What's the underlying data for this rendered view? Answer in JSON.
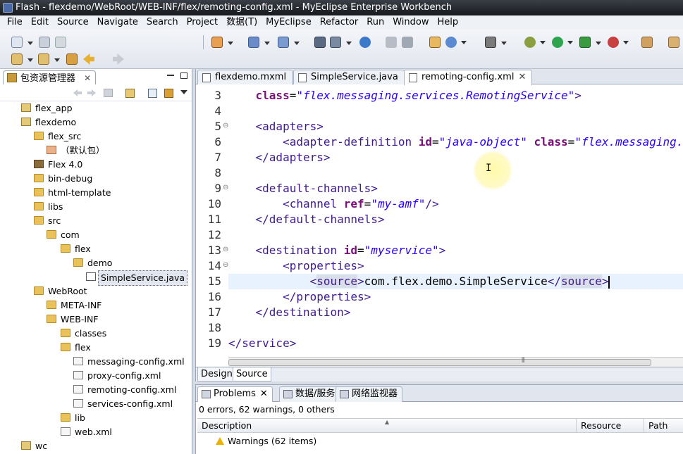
{
  "window": {
    "title": "Flash - flexdemo/WebRoot/WEB-INF/flex/remoting-config.xml - MyEclipse Enterprise Workbench"
  },
  "menu": [
    "File",
    "Edit",
    "Source",
    "Navigate",
    "Search",
    "Project",
    "数据(T)",
    "MyEclipse",
    "Refactor",
    "Run",
    "Window",
    "Help"
  ],
  "package_explorer": {
    "title": "包资源管理器",
    "close": "✕",
    "tree": [
      {
        "label": "flex_app",
        "type": "project"
      },
      {
        "label": "flexdemo",
        "type": "project"
      },
      {
        "label": "flex_src",
        "type": "folder"
      },
      {
        "label": "（默认包）",
        "type": "pkg"
      },
      {
        "label": "Flex 4.0",
        "type": "lib"
      },
      {
        "label": "bin-debug",
        "type": "folder"
      },
      {
        "label": "html-template",
        "type": "folder"
      },
      {
        "label": "libs",
        "type": "folder"
      },
      {
        "label": "src",
        "type": "folder"
      },
      {
        "label": "com",
        "type": "folder"
      },
      {
        "label": "flex",
        "type": "folder"
      },
      {
        "label": "demo",
        "type": "folder"
      },
      {
        "label": "SimpleService.java",
        "type": "java"
      },
      {
        "label": "WebRoot",
        "type": "folder"
      },
      {
        "label": "META-INF",
        "type": "folder"
      },
      {
        "label": "WEB-INF",
        "type": "folder"
      },
      {
        "label": "classes",
        "type": "folder"
      },
      {
        "label": "flex",
        "type": "folder"
      },
      {
        "label": "messaging-config.xml",
        "type": "xml"
      },
      {
        "label": "proxy-config.xml",
        "type": "xml"
      },
      {
        "label": "remoting-config.xml",
        "type": "xml"
      },
      {
        "label": "services-config.xml",
        "type": "xml"
      },
      {
        "label": "lib",
        "type": "folder"
      },
      {
        "label": "web.xml",
        "type": "xml"
      },
      {
        "label": "wc",
        "type": "project"
      }
    ]
  },
  "editor": {
    "tabs": [
      {
        "label": "flexdemo.mxml",
        "active": false
      },
      {
        "label": "SimpleService.java",
        "active": false
      },
      {
        "label": "remoting-config.xml",
        "active": true
      }
    ],
    "tab_close": "✕",
    "lines": [
      {
        "n": "3",
        "fold": "",
        "indent": "    ",
        "parts": [
          [
            "attr",
            "class"
          ],
          [
            "plain",
            "="
          ],
          [
            "val",
            "\"flex.messaging.services.RemotingService\""
          ],
          [
            "tag",
            ">"
          ]
        ]
      },
      {
        "n": "4",
        "fold": "",
        "indent": "",
        "parts": []
      },
      {
        "n": "5",
        "fold": "⊖",
        "indent": "    ",
        "parts": [
          [
            "tag",
            "<adapters>"
          ]
        ]
      },
      {
        "n": "6",
        "fold": "",
        "indent": "        ",
        "parts": [
          [
            "tag",
            "<adapter-definition "
          ],
          [
            "attr",
            "id"
          ],
          [
            "plain",
            "="
          ],
          [
            "val",
            "\"java-object\""
          ],
          [
            "plain",
            " "
          ],
          [
            "attr",
            "class"
          ],
          [
            "plain",
            "="
          ],
          [
            "val",
            "\"flex.messaging.services.remoting.adapters.JavaAdapter\""
          ]
        ]
      },
      {
        "n": "7",
        "fold": "",
        "indent": "    ",
        "parts": [
          [
            "tag",
            "</adapters>"
          ]
        ]
      },
      {
        "n": "8",
        "fold": "",
        "indent": "",
        "parts": []
      },
      {
        "n": "9",
        "fold": "⊖",
        "indent": "    ",
        "parts": [
          [
            "tag",
            "<default-channels>"
          ]
        ]
      },
      {
        "n": "10",
        "fold": "",
        "indent": "        ",
        "parts": [
          [
            "tag",
            "<channel "
          ],
          [
            "attr",
            "ref"
          ],
          [
            "plain",
            "="
          ],
          [
            "val",
            "\"my-amf\""
          ],
          [
            "tag",
            "/>"
          ]
        ]
      },
      {
        "n": "11",
        "fold": "",
        "indent": "    ",
        "parts": [
          [
            "tag",
            "</default-channels>"
          ]
        ]
      },
      {
        "n": "12",
        "fold": "",
        "indent": "",
        "parts": []
      },
      {
        "n": "13",
        "fold": "⊖",
        "indent": "    ",
        "parts": [
          [
            "tag",
            "<destination "
          ],
          [
            "attr",
            "id"
          ],
          [
            "plain",
            "="
          ],
          [
            "val",
            "\"myservice\""
          ],
          [
            "tag",
            ">"
          ]
        ]
      },
      {
        "n": "14",
        "fold": "⊖",
        "indent": "        ",
        "parts": [
          [
            "tag",
            "<properties>"
          ]
        ]
      },
      {
        "n": "15",
        "fold": "",
        "indent": "            ",
        "parts": [
          [
            "tag",
            "<"
          ],
          [
            "taghl",
            "source"
          ],
          [
            "tag",
            ">"
          ],
          [
            "plain",
            "com.flex.demo.SimpleService"
          ],
          [
            "tag",
            "</"
          ],
          [
            "taghl",
            "source"
          ],
          [
            "tag",
            ">"
          ]
        ],
        "current": true
      },
      {
        "n": "16",
        "fold": "",
        "indent": "        ",
        "parts": [
          [
            "tag",
            "</properties>"
          ]
        ]
      },
      {
        "n": "17",
        "fold": "",
        "indent": "    ",
        "parts": [
          [
            "tag",
            "</destination>"
          ]
        ]
      },
      {
        "n": "18",
        "fold": "",
        "indent": "",
        "parts": []
      },
      {
        "n": "19",
        "fold": "",
        "indent": "",
        "parts": [
          [
            "tag",
            "</service>"
          ]
        ]
      }
    ],
    "bottom_tabs": [
      "Design",
      "Source"
    ],
    "scroll_grip": "⦀"
  },
  "problems": {
    "tabs": [
      {
        "label": "Problems",
        "active": true
      },
      {
        "label": "数据/服务",
        "active": false
      },
      {
        "label": "网络监视器",
        "active": false
      }
    ],
    "summary": "0 errors, 62 warnings, 0 others",
    "columns": [
      "Description",
      "Resource",
      "Path"
    ],
    "rows": [
      {
        "description": "Warnings (62 items)"
      }
    ]
  },
  "colors": {
    "tag": "#3f1b8f",
    "attr": "#7a0f7a",
    "value": "#2a00ff",
    "current_line": "#e8f2fe"
  }
}
